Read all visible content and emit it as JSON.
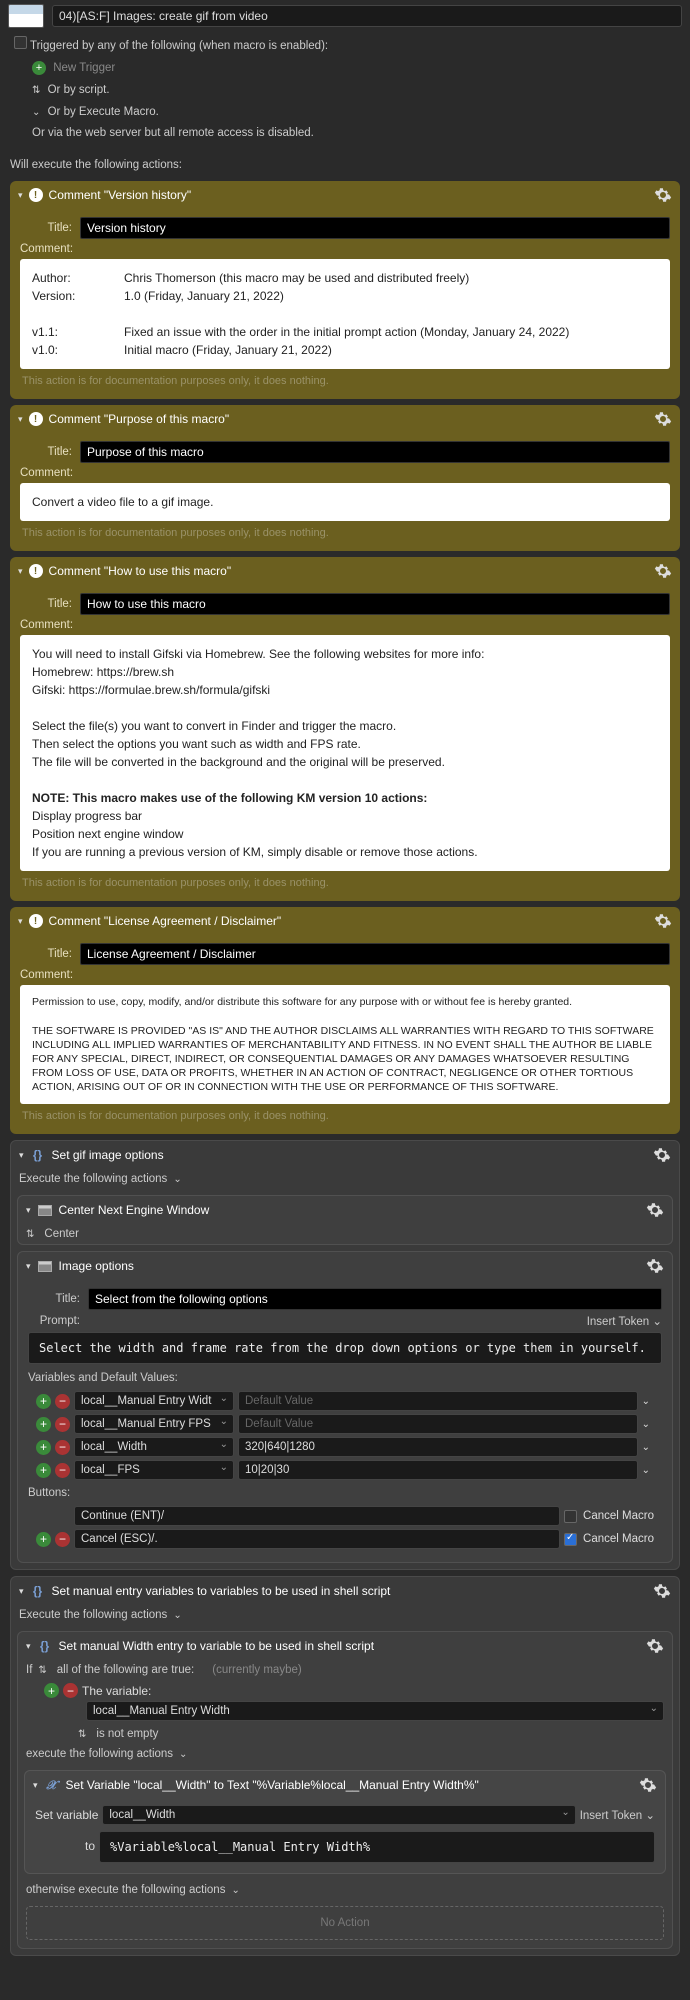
{
  "header": {
    "macro_name": "04)[AS:F] Images: create gif from video"
  },
  "triggers": {
    "heading": "Triggered by any of the following (when macro is enabled):",
    "new_trigger": "New Trigger",
    "or_script": "Or by script.",
    "or_execute": "Or by Execute Macro.",
    "or_web": "Or via the web server but all remote access is disabled."
  },
  "exec_label": "Will execute the following actions:",
  "comments": [
    {
      "head": "Comment \"Version history\"",
      "title_label": "Title:",
      "title_value": "Version history",
      "comment_label": "Comment:",
      "body_rows": [
        [
          "Author:",
          "Chris Thomerson (this macro may be used and distributed freely)"
        ],
        [
          "Version:",
          "1.0 (Friday, January 21, 2022)"
        ],
        [
          "",
          ""
        ],
        [
          "v1.1:",
          "Fixed an issue with the order in the initial prompt action (Monday, January 24, 2022)"
        ],
        [
          "v1.0:",
          "Initial macro (Friday, January 21, 2022)"
        ]
      ],
      "footnote": "This action is for documentation purposes only, it does nothing."
    },
    {
      "head": "Comment \"Purpose of this macro\"",
      "title_label": "Title:",
      "title_value": "Purpose of this macro",
      "comment_label": "Comment:",
      "body_text": "Convert a video file to a gif image.",
      "footnote": "This action is for documentation purposes only, it does nothing."
    },
    {
      "head": "Comment \"How to use this macro\"",
      "title_label": "Title:",
      "title_value": "How to use this macro",
      "comment_label": "Comment:",
      "body_lines": [
        "You will need to install Gifski via Homebrew. See the following websites for more info:",
        "Homebrew:       https://brew.sh",
        "Gifski:               https://formulae.brew.sh/formula/gifski",
        "",
        "Select the file(s) you want to convert in Finder and trigger the macro.",
        "Then select the options you want such as width and FPS rate.",
        "The file will be converted in the background and the original will be preserved.",
        "",
        "<b>NOTE: This macro makes use of the following KM version 10 actions:</b>",
        "Display progress bar",
        "Position next engine window",
        "If you are running a previous version of KM, simply disable or remove those actions."
      ],
      "footnote": "This action is for documentation purposes only, it does nothing."
    },
    {
      "head": "Comment \"License Agreement / Disclaimer\"",
      "title_label": "Title:",
      "title_value": "License Agreement / Disclaimer",
      "comment_label": "Comment:",
      "body_small": [
        "Permission to use, copy, modify, and/or distribute this software for any purpose with or without fee is hereby granted.",
        "",
        "THE SOFTWARE IS PROVIDED \"AS IS\" AND THE AUTHOR DISCLAIMS ALL WARRANTIES WITH REGARD TO THIS SOFTWARE INCLUDING ALL IMPLIED WARRANTIES OF MERCHANTABILITY AND FITNESS. IN NO EVENT SHALL THE AUTHOR BE LIABLE FOR ANY SPECIAL, DIRECT, INDIRECT, OR CONSEQUENTIAL DAMAGES OR ANY DAMAGES WHATSOEVER RESULTING FROM LOSS OF USE, DATA OR PROFITS, WHETHER IN AN ACTION OF CONTRACT, NEGLIGENCE OR OTHER TORTIOUS ACTION, ARISING OUT OF OR IN CONNECTION WITH THE USE OR PERFORMANCE OF THIS SOFTWARE."
      ],
      "footnote": "This action is for documentation purposes only, it does nothing."
    }
  ],
  "group1": {
    "head": "Set gif image options",
    "exec_label": "Execute the following actions",
    "center_head": "Center Next Engine Window",
    "center_val": "Center",
    "image_opts": {
      "head": "Image options",
      "title_label": "Title:",
      "title_value": "Select from the following options",
      "prompt_label": "Prompt:",
      "insert_token": "Insert Token",
      "prompt_text": "Select the width and frame rate from the drop down options or type them in yourself.",
      "vars_label": "Variables and Default Values:",
      "vars": [
        {
          "name": "local__Manual Entry Widt",
          "placeholder": "Default Value",
          "value": ""
        },
        {
          "name": "local__Manual Entry FPS",
          "placeholder": "Default Value",
          "value": ""
        },
        {
          "name": "local__Width",
          "placeholder": "",
          "value": "320|640|1280"
        },
        {
          "name": "local__FPS",
          "placeholder": "",
          "value": "10|20|30"
        }
      ],
      "buttons_label": "Buttons:",
      "buttons": [
        {
          "label": "Continue (ENT)/",
          "cancel_checked": false,
          "cancel_label": "Cancel Macro"
        },
        {
          "label": "Cancel (ESC)/.",
          "cancel_checked": true,
          "cancel_label": "Cancel Macro"
        }
      ]
    }
  },
  "group2": {
    "head": "Set manual entry variables to variables to be used in shell script",
    "exec_label": "Execute the following actions",
    "if_group": {
      "head": "Set manual Width entry to variable to be used in shell script",
      "if_label": "If",
      "all_label": "all of the following are true:",
      "currently": "(currently maybe)",
      "cond_label": "The variable:",
      "cond_var": "local__Manual Entry Width",
      "cond_op": "is not empty",
      "then_label": "execute the following actions",
      "setvar": {
        "head": "Set Variable \"local__Width\" to Text \"%Variable%local__Manual Entry Width%\"",
        "set_label": "Set variable",
        "var_name": "local__Width",
        "insert_token": "Insert Token",
        "to_label": "to",
        "to_value": "%Variable%local__Manual Entry Width%"
      },
      "else_label": "otherwise execute the following actions",
      "no_action": "No Action"
    }
  }
}
